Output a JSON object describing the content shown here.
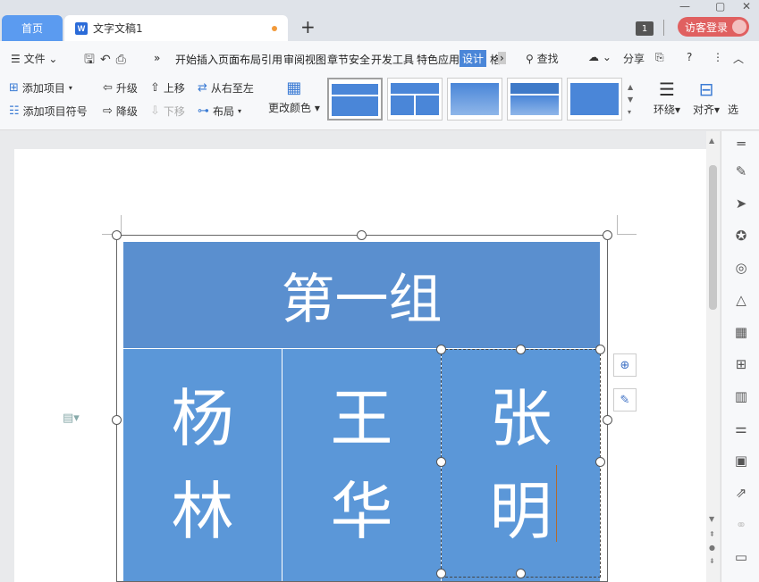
{
  "tabs": {
    "home": "首页",
    "doc": "文字文稿1",
    "doc_icon": "W",
    "new_tab": "+"
  },
  "window": {
    "badge": "1",
    "login": "访客登录",
    "min": "—",
    "max": "▢",
    "close": "✕"
  },
  "menu": {
    "file": "文件",
    "more": "»",
    "items": [
      "开始",
      "插入",
      "页面布局",
      "引用",
      "审阅",
      "视图",
      "章节",
      "安全",
      "开发工具",
      "特色应用",
      "设计",
      "格"
    ],
    "active": "设计",
    "search": "查找",
    "share": "分享",
    "help": "?"
  },
  "ribbon": {
    "add_item": "添加项目",
    "add_bullet": "添加项目符号",
    "promote": "升级",
    "demote": "降级",
    "move_up": "上移",
    "move_down": "下移",
    "rtl": "从右至左",
    "layout": "布局",
    "change_color": "更改颜色",
    "wrap": "环绕",
    "align": "对齐",
    "select": "选"
  },
  "smartart": {
    "header": "第一组",
    "names": [
      {
        "line1": "杨",
        "line2": "林"
      },
      {
        "line1": "王",
        "line2": "华"
      },
      {
        "line1": "张",
        "line2": "明"
      }
    ]
  },
  "colors": {
    "accent": "#4a86d8",
    "header_fill": "#5a8fcf",
    "box_fill": "#5b97d8",
    "login_red": "#e06060"
  }
}
